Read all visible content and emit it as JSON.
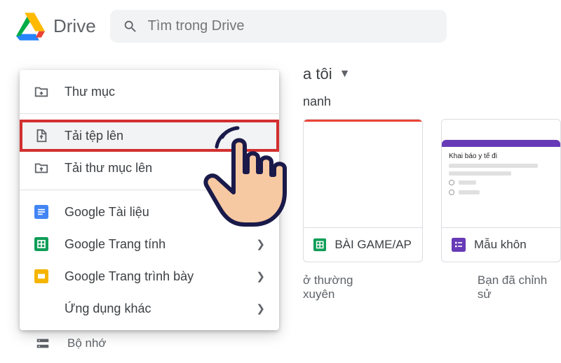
{
  "header": {
    "app_title": "Drive",
    "search_placeholder": "Tìm trong Drive"
  },
  "breadcrumb": {
    "text": "a tôi"
  },
  "section_label": "nanh",
  "menu": {
    "new_folder": "Thư mục",
    "upload_file": "Tải tệp lên",
    "upload_folder": "Tải thư mục lên",
    "gdocs": "Google Tài liệu",
    "gsheets": "Google Trang tính",
    "gslides": "Google Trang trình bày",
    "more_apps": "Ứng dụng khác"
  },
  "cards": {
    "card1": {
      "title": "BÀI GAME/APP",
      "sub": "ở thường xuyên"
    },
    "card2": {
      "title": "Mẫu khôn",
      "sub": "Bạn đã chỉnh sử",
      "form_title": "Khai báo y tế đi"
    }
  },
  "sidebar": {
    "storage_label": "Bộ nhớ"
  }
}
